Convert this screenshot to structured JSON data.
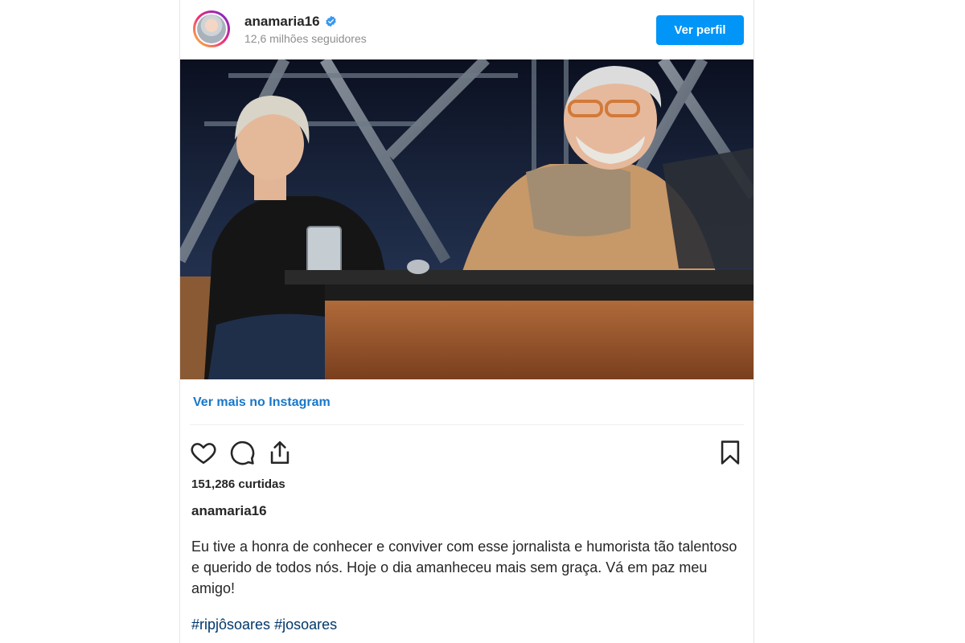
{
  "header": {
    "username": "anamaria16",
    "followers": "12,6 milhões seguidores",
    "profile_button": "Ver perfil"
  },
  "post": {
    "photo_icon": "post-photo",
    "more_link": "Ver mais no Instagram",
    "likes": "151,286 curtidas",
    "caption_username": "anamaria16",
    "caption": "Eu tive a honra de conhecer e conviver com esse jornalista e humorista tão talentoso e querido de todos nós. Hoje o dia amanheceu mais sem graça. Vá em paz meu amigo!",
    "hashtags": [
      "#ripjôsoares",
      "#josoares"
    ]
  },
  "icons": {
    "like": "heart-icon",
    "comment": "comment-icon",
    "share": "share-icon",
    "save": "bookmark-icon",
    "verified": "verified-badge-icon"
  },
  "colors": {
    "accent": "#0095f6",
    "link": "#1877c9",
    "hashtag": "#00376b",
    "text": "#262626",
    "muted": "#8e8e8e"
  }
}
